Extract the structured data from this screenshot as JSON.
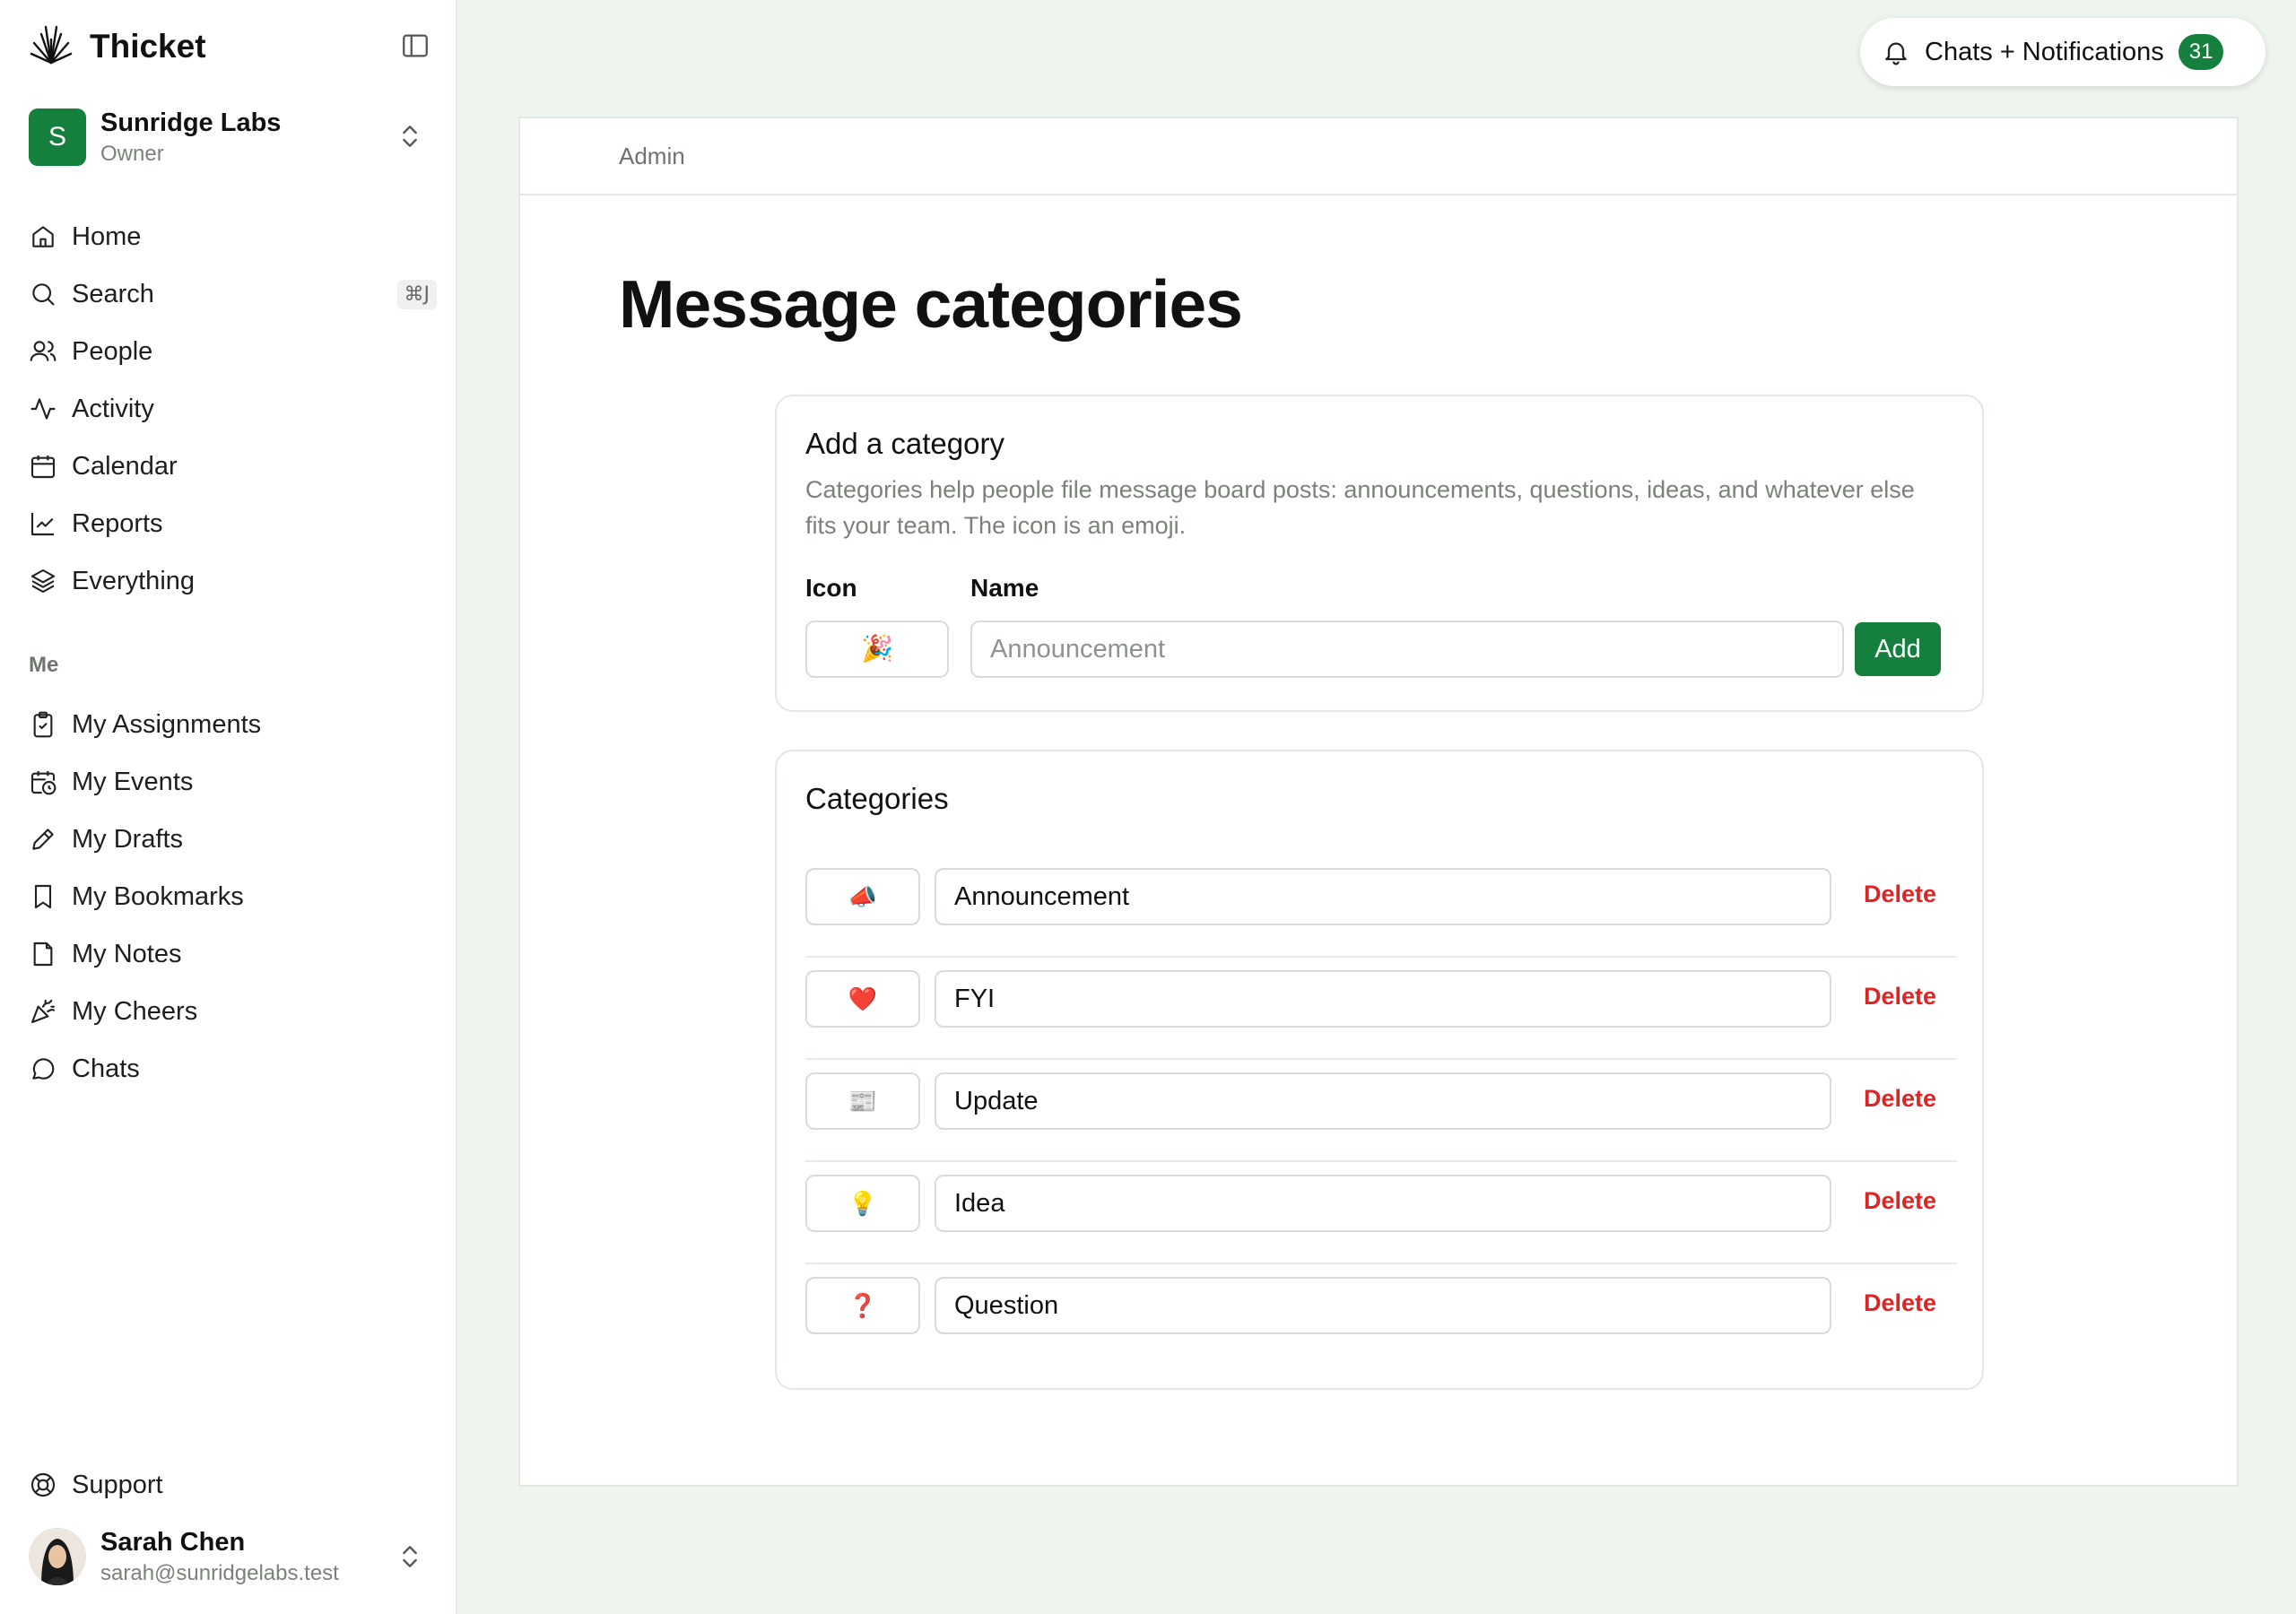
{
  "app": {
    "name": "Thicket"
  },
  "workspace": {
    "name": "Sunridge Labs",
    "role": "Owner",
    "initial": "S"
  },
  "nav": {
    "main": [
      {
        "label": "Home",
        "icon": "home-icon"
      },
      {
        "label": "Search",
        "icon": "search-icon",
        "shortcut": "⌘J"
      },
      {
        "label": "People",
        "icon": "people-icon"
      },
      {
        "label": "Activity",
        "icon": "activity-icon"
      },
      {
        "label": "Calendar",
        "icon": "calendar-icon"
      },
      {
        "label": "Reports",
        "icon": "chart-icon"
      },
      {
        "label": "Everything",
        "icon": "layers-icon"
      }
    ],
    "me_label": "Me",
    "me": [
      {
        "label": "My Assignments",
        "icon": "clipboard-check-icon"
      },
      {
        "label": "My Events",
        "icon": "calendar-clock-icon"
      },
      {
        "label": "My Drafts",
        "icon": "pencil-icon"
      },
      {
        "label": "My Bookmarks",
        "icon": "bookmark-icon"
      },
      {
        "label": "My Notes",
        "icon": "note-icon"
      },
      {
        "label": "My Cheers",
        "icon": "party-icon"
      },
      {
        "label": "Chats",
        "icon": "chat-bubble-icon"
      }
    ],
    "support": "Support"
  },
  "user": {
    "name": "Sarah Chen",
    "email": "sarah@sunridgelabs.test"
  },
  "notifications": {
    "label": "Chats + Notifications",
    "count": "31"
  },
  "breadcrumb": "Admin",
  "page_title": "Message categories",
  "add_form": {
    "title": "Add a category",
    "description": "Categories help people file message board posts: announcements, questions, ideas, and whatever else fits your team. The icon is an emoji.",
    "icon_label": "Icon",
    "name_label": "Name",
    "icon_value": "🎉",
    "name_placeholder": "Announcement",
    "add_button": "Add"
  },
  "categories": {
    "title": "Categories",
    "delete_label": "Delete",
    "items": [
      {
        "icon": "📣",
        "name": "Announcement"
      },
      {
        "icon": "❤️",
        "name": "FYI"
      },
      {
        "icon": "📰",
        "name": "Update"
      },
      {
        "icon": "💡",
        "name": "Idea"
      },
      {
        "icon": "❓",
        "name": "Question"
      }
    ]
  },
  "colors": {
    "accent": "#15803d",
    "danger": "#dc2626",
    "background": "#eef4ee"
  }
}
